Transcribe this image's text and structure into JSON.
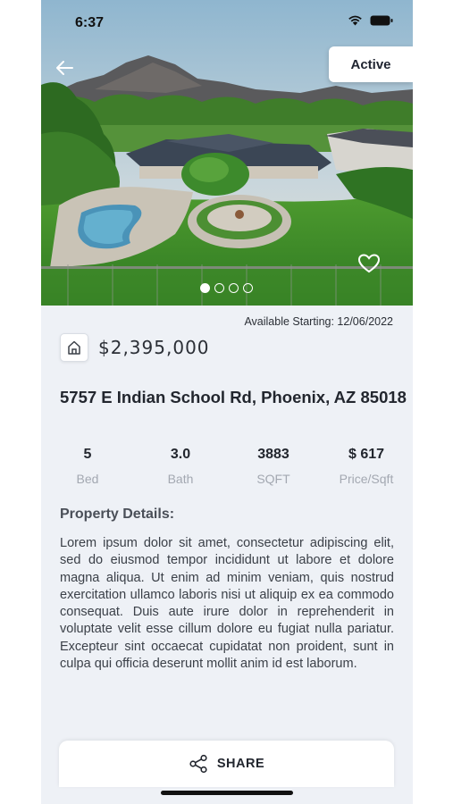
{
  "status_bar": {
    "time": "6:37"
  },
  "listing": {
    "status": "Active",
    "photo_count": 4,
    "active_photo_index": 0,
    "available_starting": "Available Starting: 12/06/2022",
    "price": "$2,395,000",
    "address": "5757 E Indian School Rd, Phoenix, AZ 85018"
  },
  "stats": [
    {
      "value": "5",
      "label": "Bed"
    },
    {
      "value": "3.0",
      "label": "Bath"
    },
    {
      "value": "3883",
      "label": "SQFT"
    },
    {
      "value": "$ 617",
      "label": "Price/Sqft"
    }
  ],
  "details": {
    "title": "Property Details:",
    "description": "Lorem ipsum dolor sit amet, consectetur adipiscing elit, sed do eiusmod tempor incididunt ut labore et dolore magna aliqua. Ut enim ad minim veniam, quis nostrud exercitation ullamco laboris nisi ut aliquip ex ea commodo consequat. Duis aute irure dolor in reprehenderit in voluptate velit esse cillum dolore eu fugiat nulla pariatur. Excepteur sint occaecat cupidatat non proident, sunt in culpa qui officia deserunt mollit anim id est laborum."
  },
  "actions": {
    "share_label": "SHARE"
  },
  "icons": {
    "back": "arrow-left-icon",
    "favorite": "heart-icon",
    "property": "house-icon",
    "share": "share-icon"
  }
}
